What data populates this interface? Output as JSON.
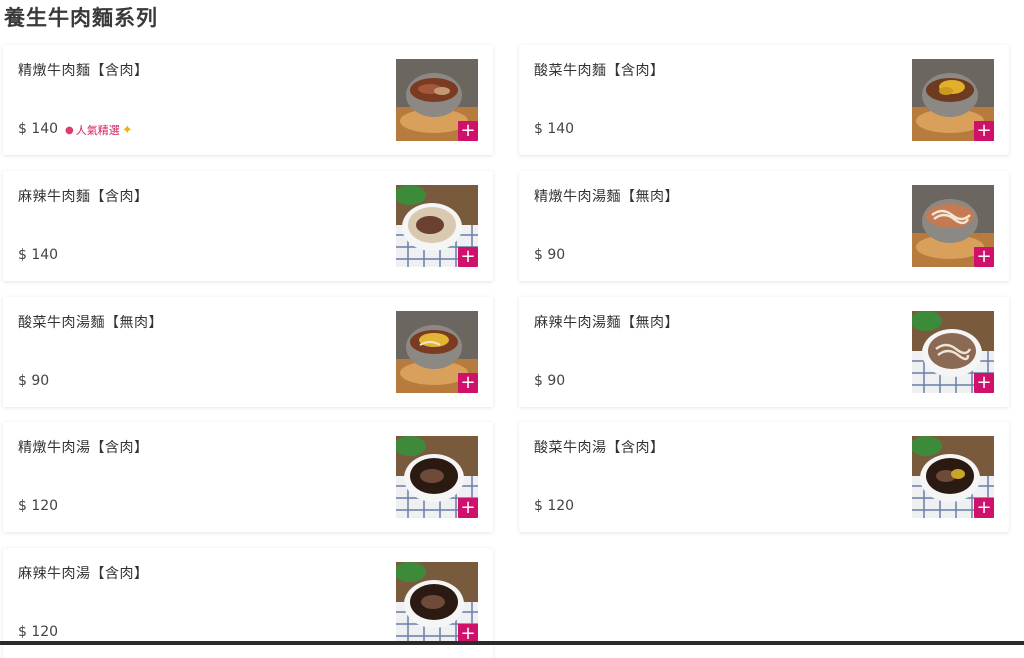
{
  "section": {
    "title": "養生牛肉麵系列"
  },
  "items": [
    {
      "name": "精燉牛肉麵【含肉】",
      "price": "$ 140",
      "badge": "人氣精選",
      "photo": "noodle-beef-bowl"
    },
    {
      "name": "酸菜牛肉麵【含肉】",
      "price": "$ 140",
      "photo": "noodle-pickle-bowl"
    },
    {
      "name": "麻辣牛肉麵【含肉】",
      "price": "$ 140",
      "photo": "spicy-noodle-bowl"
    },
    {
      "name": "精燉牛肉湯麵【無肉】",
      "price": "$ 90",
      "photo": "noodle-broth-bowl"
    },
    {
      "name": "酸菜牛肉湯麵【無肉】",
      "price": "$ 90",
      "photo": "pickle-noodle-bowl"
    },
    {
      "name": "麻辣牛肉湯麵【無肉】",
      "price": "$ 90",
      "photo": "spicy-broth-noodle-bowl"
    },
    {
      "name": "精燉牛肉湯【含肉】",
      "price": "$ 120",
      "photo": "beef-soup-bowl"
    },
    {
      "name": "酸菜牛肉湯【含肉】",
      "price": "$ 120",
      "photo": "pickle-beef-soup-bowl"
    },
    {
      "name": "麻辣牛肉湯【含肉】",
      "price": "$ 120",
      "photo": "spicy-beef-soup-bowl"
    }
  ],
  "add_button": {
    "symbol": "+"
  },
  "colors": {
    "accent": "#d0116b",
    "badge_text": "#d81b60"
  }
}
